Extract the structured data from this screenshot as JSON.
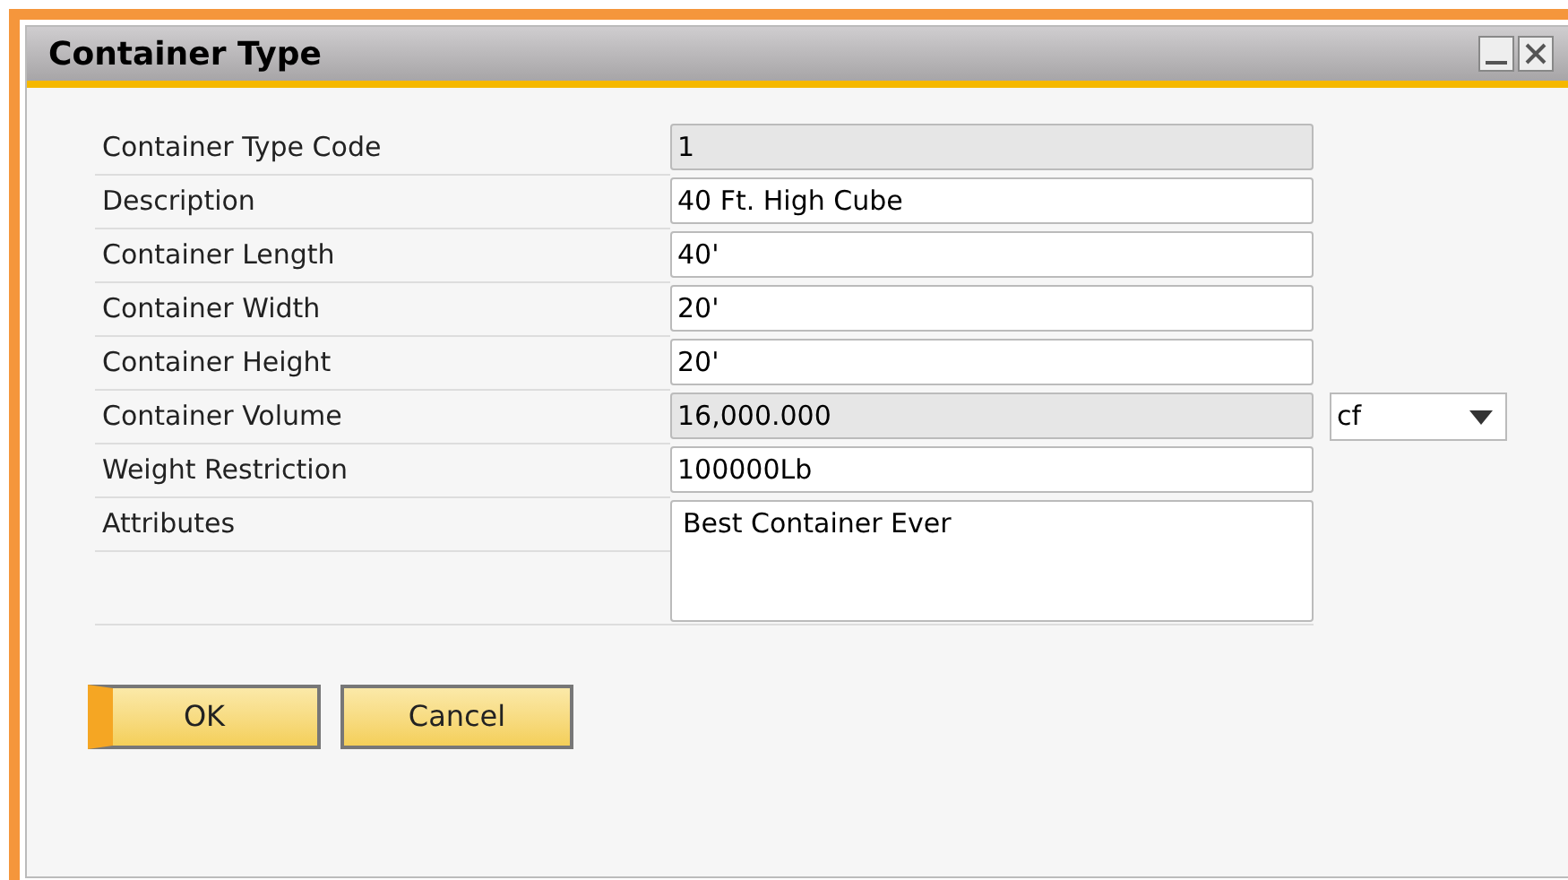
{
  "window": {
    "title": "Container Type"
  },
  "fields": [
    {
      "label": "Container Type Code",
      "value": "1",
      "disabled": true,
      "kind": "text"
    },
    {
      "label": "Description",
      "value": "40 Ft. High Cube",
      "disabled": false,
      "kind": "text"
    },
    {
      "label": "Container Length",
      "value": "40'",
      "disabled": false,
      "kind": "text"
    },
    {
      "label": "Container Width",
      "value": "20'",
      "disabled": false,
      "kind": "text"
    },
    {
      "label": "Container Height",
      "value": "20'",
      "disabled": false,
      "kind": "text"
    },
    {
      "label": "Container Volume",
      "value": "16,000.000",
      "disabled": true,
      "kind": "text",
      "unit": "cf"
    },
    {
      "label": "Weight Restriction",
      "value": "100000Lb",
      "disabled": false,
      "kind": "text"
    },
    {
      "label": "Attributes",
      "value": "Best Container Ever",
      "disabled": false,
      "kind": "multiline"
    }
  ],
  "buttons": [
    {
      "label": "OK",
      "default": true
    },
    {
      "label": "Cancel",
      "default": false
    }
  ]
}
